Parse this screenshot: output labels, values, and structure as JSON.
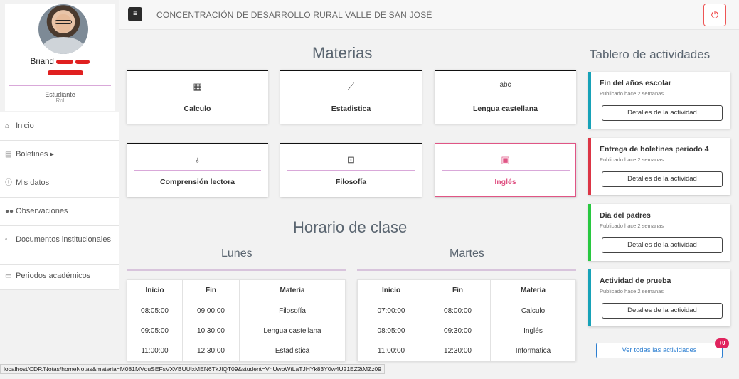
{
  "profile": {
    "name": "Briand",
    "role": "Estudiante",
    "role_sub": "Rol"
  },
  "sidebar": {
    "items": [
      {
        "icon": "home-icon",
        "label": "Inicio"
      },
      {
        "icon": "document-icon",
        "label": "Boletines ▸"
      },
      {
        "icon": "info-icon",
        "label": "Mis datos"
      },
      {
        "icon": "glasses-icon",
        "label": "Observaciones"
      },
      {
        "icon": "file-icon",
        "label": "Documentos institucionales"
      },
      {
        "icon": "calendar-icon",
        "label": "Periodos académicos"
      }
    ]
  },
  "header": {
    "menu_label": "≡",
    "title": "CONCENTRACIÓN DE DESARROLLO RURAL VALLE DE SAN JOSÉ",
    "power_label": "⏻"
  },
  "materias": {
    "title": "Materias",
    "items": [
      {
        "icon": "calculator-icon",
        "glyph": "▦",
        "label": "Calculo",
        "active": false
      },
      {
        "icon": "chart-line-icon",
        "glyph": "⟋",
        "label": "Estadistica",
        "active": false
      },
      {
        "icon": "spellcheck-icon",
        "glyph": "abc",
        "label": "Lengua castellana",
        "active": false
      },
      {
        "icon": "award-icon",
        "glyph": "♁",
        "label": "Comprensión lectora",
        "active": false
      },
      {
        "icon": "bookmark-icon",
        "glyph": "⊡",
        "label": "Filosofía",
        "active": false
      },
      {
        "icon": "translate-icon",
        "glyph": "▣",
        "label": "Inglés",
        "active": true
      }
    ]
  },
  "horario": {
    "title": "Horario de clase",
    "headers": [
      "Inicio",
      "Fin",
      "Materia"
    ],
    "lunes": {
      "day": "Lunes",
      "rows": [
        [
          "08:05:00",
          "09:00:00",
          "Filosofía"
        ],
        [
          "09:05:00",
          "10:30:00",
          "Lengua castellana"
        ],
        [
          "11:00:00",
          "12:30:00",
          "Estadistica"
        ]
      ]
    },
    "martes": {
      "day": "Martes",
      "rows": [
        [
          "07:00:00",
          "08:00:00",
          "Calculo"
        ],
        [
          "08:05:00",
          "09:30:00",
          "Inglés"
        ],
        [
          "11:00:00",
          "12:30:00",
          "Informatica"
        ]
      ]
    }
  },
  "actividades": {
    "title": "Tablero de actividades",
    "button_label": "Detalles de la actividad",
    "items": [
      {
        "title": "Fin del años escolar",
        "published": "Publicado hace 2 semanas",
        "color": "#17a2b8"
      },
      {
        "title": "Entrega de boletines periodo 4",
        "published": "Publicado hace 2 semanas",
        "color": "#dc3545"
      },
      {
        "title": "Dia del padres",
        "published": "Publicado hace 2 semanas",
        "color": "#28c840"
      },
      {
        "title": "Actividad de prueba",
        "published": "Publicado hace 2 semanas",
        "color": "#17a2b8"
      }
    ],
    "all_label": "Ver todas las actividades",
    "badge": "+0"
  },
  "status_url": "localhost/CDR/Notas/homeNotas&materia=M081MVduSEFsVXVBUUlxMEN6TkJlQT09&student=VnUwbWtLaTJHYk83Y0w4U21EZ2tMZz09"
}
